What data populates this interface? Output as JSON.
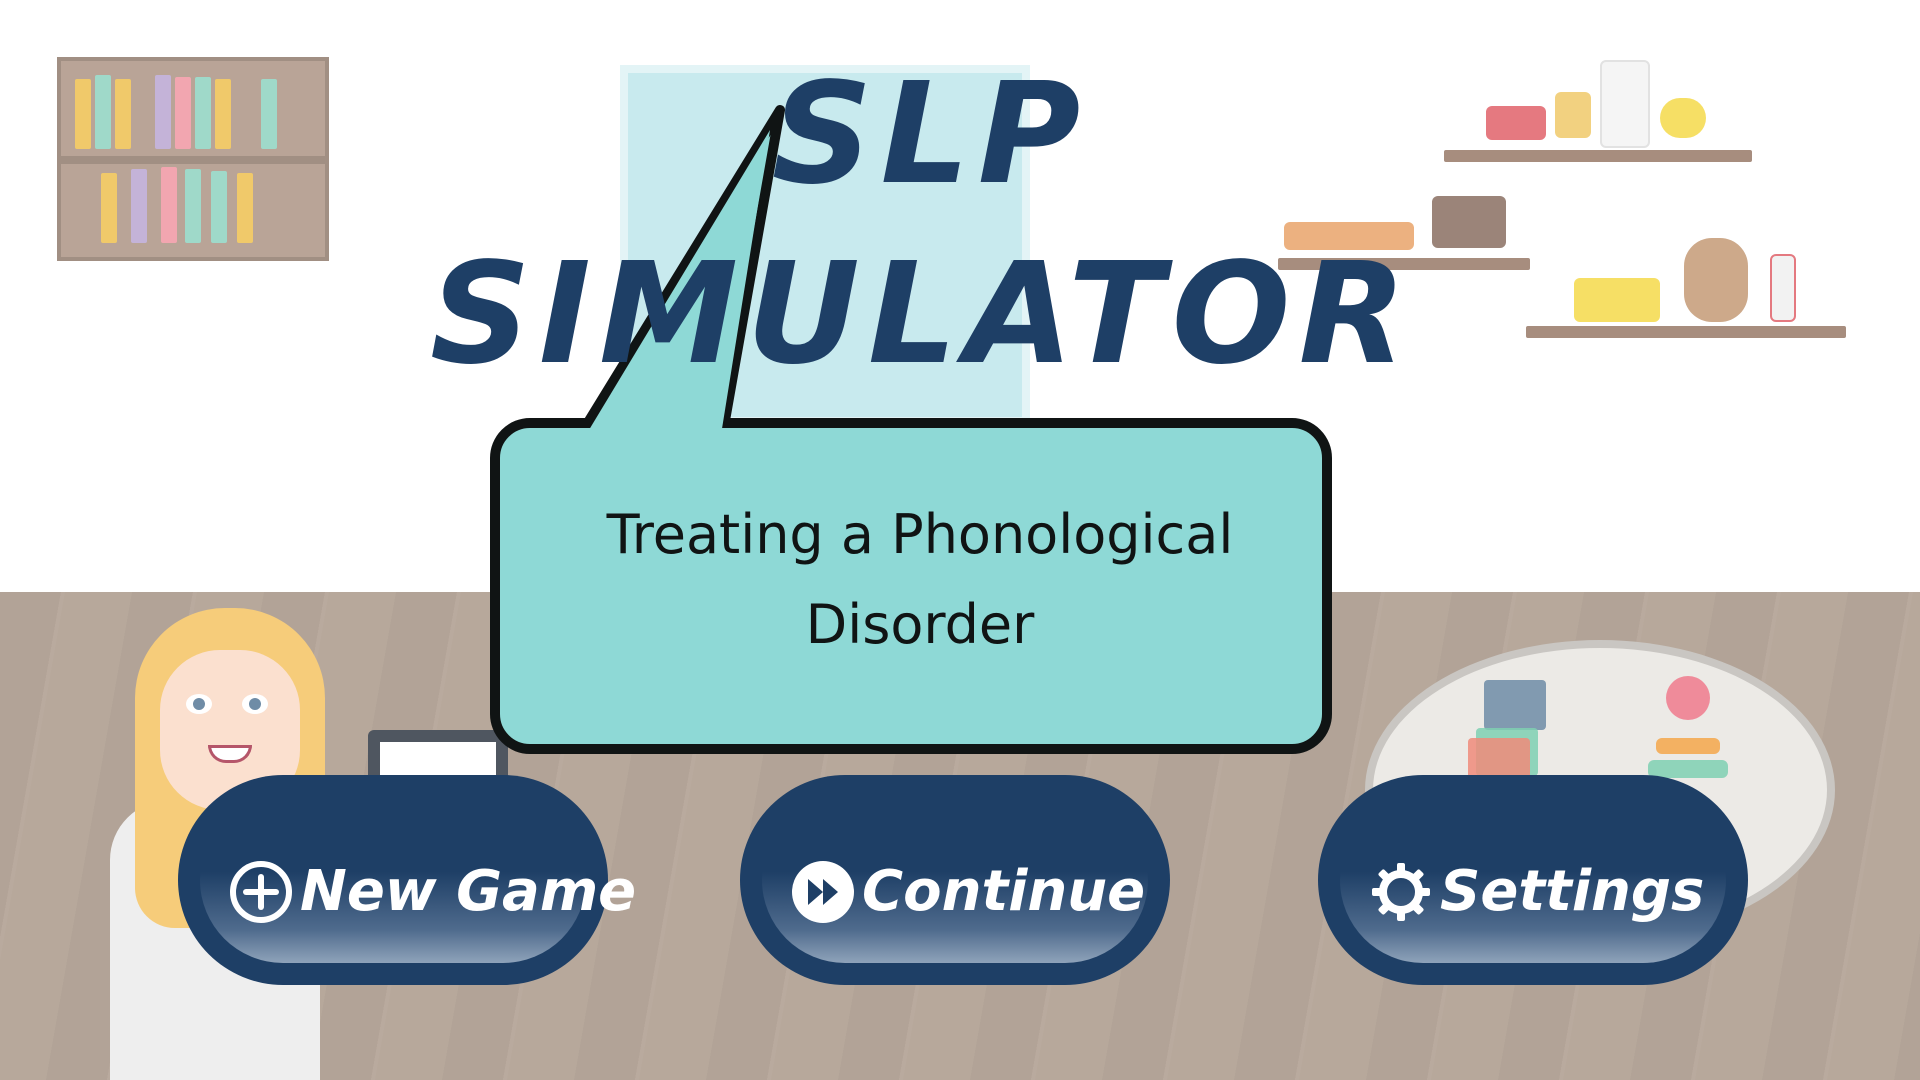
{
  "game": {
    "title_line1": "SLP",
    "title_line2": "SIMULATOR",
    "subtitle": "Treating a Phonological Disorder"
  },
  "menu": {
    "new_game": {
      "label": "New Game",
      "icon": "plus-circle-icon"
    },
    "continue": {
      "label": "Continue",
      "icon": "fast-forward-icon"
    },
    "settings": {
      "label": "Settings",
      "icon": "gear-icon"
    }
  },
  "colors": {
    "title_navy": "#1e3f66",
    "bubble_teal": "#8ed9d6",
    "bubble_border": "#101414",
    "button_fill": "#1e3f66",
    "floor": "#a89789"
  }
}
